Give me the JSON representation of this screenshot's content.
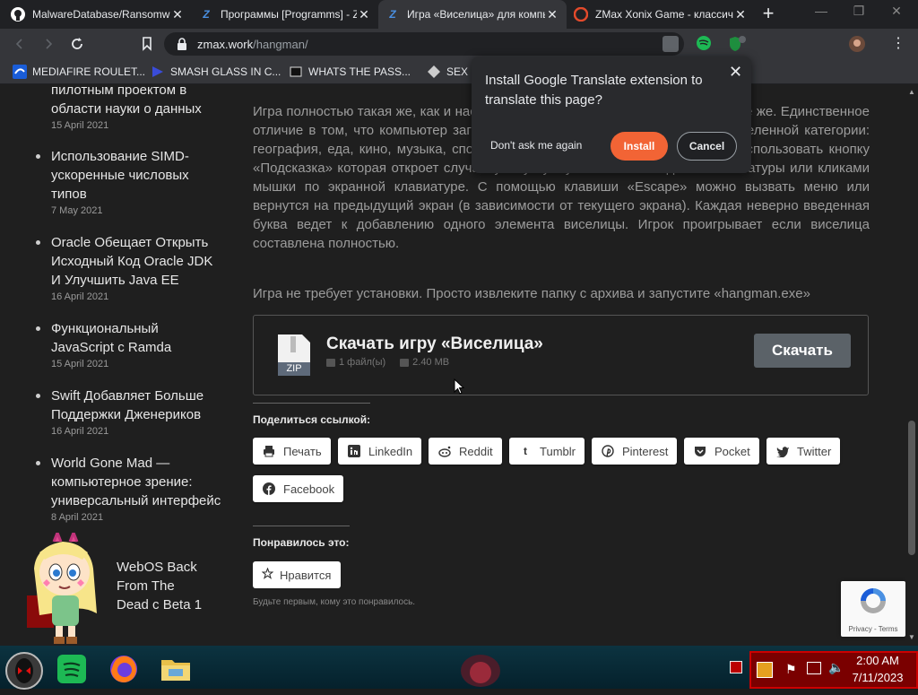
{
  "tabs": [
    {
      "title": "MalwareDatabase/Ransomw",
      "favicon": "github-icon"
    },
    {
      "title": "Программы [Programms] - Z",
      "favicon": "zmax-icon"
    },
    {
      "title": "Игра «Виселица» для компь",
      "favicon": "zmax-icon"
    },
    {
      "title": "ZMax Xonix Game - классич",
      "favicon": "zmax-red-icon"
    }
  ],
  "address": {
    "host": "zmax.work",
    "path": "/hangman/"
  },
  "bookmarks": [
    {
      "label": "MEDIAFIRE ROULET...",
      "icon": "mediafire-icon"
    },
    {
      "label": "SMASH GLASS IN C...",
      "icon": "bookmark-icon"
    },
    {
      "label": "WHATS THE PASS...",
      "icon": "bookmark-icon"
    },
    {
      "label": "SEX I",
      "icon": "bookmark-icon"
    }
  ],
  "sidebar_posts": [
    {
      "title": "пилотным проектом в области науки о данных",
      "date": "15 April 2021"
    },
    {
      "title": "Использование SIMD-ускоренные числовых типов",
      "date": "7 May 2021"
    },
    {
      "title": "Oracle Обещает Открыть Исходный Код Oracle JDK И Улучшить Java EE",
      "date": "16 April 2021"
    },
    {
      "title": "Функциональный JavaScript с Ramda",
      "date": "15 April 2021"
    },
    {
      "title": "Swift Добавляет Больше Поддержки Дженериков",
      "date": "16 April 2021"
    },
    {
      "title": "World Gone Mad — компьютерное зрение: универсальный интерфейс",
      "date": "8 April 2021"
    },
    {
      "title": "WebOS Back From The Dead с Beta 1",
      "date": ""
    }
  ],
  "article": {
    "para1": "Игра полностью такая же, как и настольная версия. Подход к игре стянул с нее же. Единственное отличие в том, что компьютер загадывает слово, которое относится к определенной категории: география, еда, кино, музыка, спорт и животные. Один раз за игру можно использовать кнопку «Подсказка» которая откроет случайную букву. Буквы можно вводить с клавиатуры или кликами мышки по экранной клавиатуре. С помощью клавиши «Escape» можно вызвать меню или вернутся на предыдущий экран (в зависимости от текущего экрана). Каждая неверно введенная буква ведет к добавлению одного элемента виселицы. Игрок проигрывает если виселица составлена полностью.",
    "para2": "Игра не требует установки. Просто извлеките папку с архива и запустите «hangman.exe»"
  },
  "download": {
    "title": "Скачать игру «Виселица»",
    "files": "1 файл(ы)",
    "size": "2.40 MB",
    "button": "Скачать",
    "file_type": "ZIP"
  },
  "share": {
    "heading": "Поделиться ссылкой:",
    "buttons": [
      {
        "label": "Печать",
        "icon": "print-icon"
      },
      {
        "label": "LinkedIn",
        "icon": "linkedin-icon"
      },
      {
        "label": "Reddit",
        "icon": "reddit-icon"
      },
      {
        "label": "Tumblr",
        "icon": "tumblr-icon"
      },
      {
        "label": "Pinterest",
        "icon": "pinterest-icon"
      },
      {
        "label": "Pocket",
        "icon": "pocket-icon"
      },
      {
        "label": "Twitter",
        "icon": "twitter-icon"
      },
      {
        "label": "Facebook",
        "icon": "facebook-icon"
      }
    ]
  },
  "likes": {
    "heading": "Понравилось это:",
    "button": "Нравится",
    "note": "Будьте первым, кому это понравилось."
  },
  "recaptcha": {
    "text": "Privacy - Terms"
  },
  "translate_popup": {
    "message": "Install Google Translate extension to translate this page?",
    "dont_ask": "Don't ask me again",
    "install": "Install",
    "cancel": "Cancel"
  },
  "taskbar": {
    "time": "2:00 AM",
    "date": "7/11/2023"
  },
  "colors": {
    "install_button": "#f26435",
    "page_bg": "#1f1f1f",
    "download_button": "#5b6268",
    "tray_bg": "#7a0000"
  }
}
